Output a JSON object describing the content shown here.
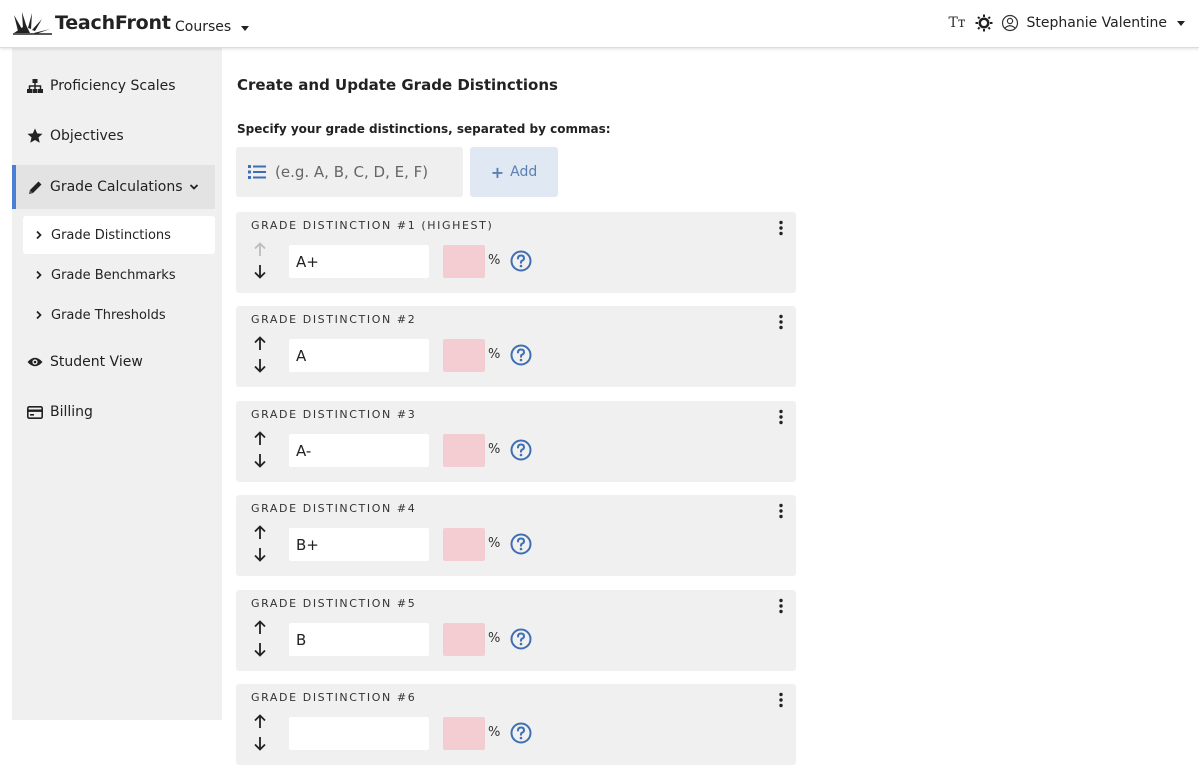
{
  "header": {
    "brand": "TeachFront",
    "courses_label": "Courses",
    "text_size_label": "Tт",
    "user_name": "Stephanie Valentine"
  },
  "sidebar": {
    "items": [
      {
        "label": "Proficiency Scales",
        "icon": "sitemap-icon"
      },
      {
        "label": "Objectives",
        "icon": "star-icon"
      },
      {
        "label": "Grade Calculations",
        "icon": "pencil-icon"
      },
      {
        "label": "Student View",
        "icon": "eye-icon"
      },
      {
        "label": "Billing",
        "icon": "credit-card-icon"
      }
    ],
    "sub_items": [
      {
        "label": "Grade Distinctions"
      },
      {
        "label": "Grade Benchmarks"
      },
      {
        "label": "Grade Thresholds"
      }
    ]
  },
  "main": {
    "title": "Create and Update Grade Distinctions",
    "spec_label": "Specify your grade distinctions, separated by commas:",
    "input_placeholder": "(e.g. A, B, C, D, E, F)",
    "add_label": "Add",
    "percent_sign": "%",
    "cards": [
      {
        "title": "GRADE DISTINCTION #1 (HIGHEST)",
        "value": "A+",
        "up_disabled": true
      },
      {
        "title": "GRADE DISTINCTION #2",
        "value": "A",
        "up_disabled": false
      },
      {
        "title": "GRADE DISTINCTION #3",
        "value": "A-",
        "up_disabled": false
      },
      {
        "title": "GRADE DISTINCTION #4",
        "value": "B+",
        "up_disabled": false
      },
      {
        "title": "GRADE DISTINCTION #5",
        "value": "B",
        "up_disabled": false
      },
      {
        "title": "GRADE DISTINCTION #6",
        "value": "",
        "up_disabled": false
      }
    ]
  },
  "colors": {
    "accent": "#4a7fd4",
    "help_icon": "#3f6fb3",
    "percent_field": "#f4cdd3",
    "add_button_bg": "#dfe8f3"
  }
}
